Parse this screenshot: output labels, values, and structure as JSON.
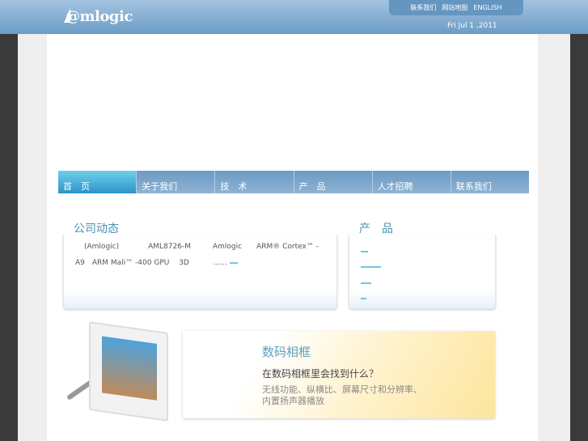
{
  "header": {
    "logo": "@mlogic",
    "links": [
      "联系我们",
      "网站地图",
      "ENGLISH"
    ],
    "date": "Fri Jul 1 ,2011"
  },
  "nav": [
    "首　页",
    "关于我们",
    "技　术",
    "产　品",
    "人才招聘",
    "联系我们"
  ],
  "news": {
    "title": "公司动态",
    "line1": "(Amlogic)　　　　AML8726-M　　　Amlogic　　ARM® Cortex™ -",
    "line2": "A9　ARM Mali™ -400 GPU　 3D　　　 ......"
  },
  "products": {
    "title": "产　品"
  },
  "banner": {
    "title": "数码相框",
    "subtitle": "在数码相框里会找到什么？",
    "desc1": "无线功能、纵横比、屏幕尺寸和分辨率、",
    "desc2": "内置扬声器播放"
  }
}
